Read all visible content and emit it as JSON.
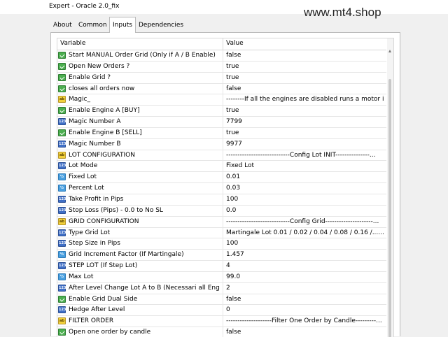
{
  "window": {
    "title": "Expert - Oracle 2.0_fix"
  },
  "watermark": "www.mt4.shop",
  "tabs": [
    {
      "label": "About",
      "active": false
    },
    {
      "label": "Common",
      "active": false
    },
    {
      "label": "Inputs",
      "active": true
    },
    {
      "label": "Dependencies",
      "active": false
    }
  ],
  "table": {
    "headers": {
      "variable": "Variable",
      "value": "Value"
    },
    "rows": [
      {
        "icon": "bool",
        "variable": "Start MANUAL Order  Grid  (Only if A / B Enable)",
        "value": "false"
      },
      {
        "icon": "bool",
        "variable": "Open New Orders ?",
        "value": "true"
      },
      {
        "icon": "bool",
        "variable": "Enable Grid ?",
        "value": "true"
      },
      {
        "icon": "bool",
        "variable": "closes all orders now",
        "value": "false"
      },
      {
        "icon": "ab",
        "variable": "Magic_",
        "value": "--------If all the engines are disabled runs a motor i..."
      },
      {
        "icon": "bool",
        "variable": "Enable Engine A   [BUY]",
        "value": "true"
      },
      {
        "icon": "int",
        "variable": "Magic Number  A",
        "value": "7799"
      },
      {
        "icon": "bool",
        "variable": "Enable Engine B   [SELL]",
        "value": "true"
      },
      {
        "icon": "int",
        "variable": "Magic Number  B",
        "value": "9977"
      },
      {
        "icon": "ab",
        "variable": "LOT CONFIGURATION",
        "value": "----------------------------Config Lot INIT---------------..."
      },
      {
        "icon": "int",
        "variable": "Lot Mode",
        "value": "Fixed Lot"
      },
      {
        "icon": "dbl",
        "variable": "Fixed Lot",
        "value": "0.01"
      },
      {
        "icon": "dbl",
        "variable": "Percent Lot",
        "value": "0.03"
      },
      {
        "icon": "int",
        "variable": "Take Profit in Pips",
        "value": "100"
      },
      {
        "icon": "int",
        "variable": "Stop Loss (Pips) - 0.0 to No SL",
        "value": "0.0"
      },
      {
        "icon": "ab",
        "variable": "GRID CONFIGURATION",
        "value": "----------------------------Config Grid---------------------..."
      },
      {
        "icon": "int",
        "variable": "Type Grid Lot",
        "value": "Martingale Lot  0.01 / 0.02 / 0.04 / 0.08 / 0.16 /........"
      },
      {
        "icon": "int",
        "variable": "Step Size in Pips",
        "value": "100"
      },
      {
        "icon": "dbl",
        "variable": "Grid Increment Factor (If Martingale)",
        "value": "1.457"
      },
      {
        "icon": "int",
        "variable": "STEP LOT (If  Step Lot)",
        "value": "4"
      },
      {
        "icon": "dbl",
        "variable": "Max Lot",
        "value": "99.0"
      },
      {
        "icon": "int",
        "variable": "After Level Change Lot A to B (Necessari all Engi...",
        "value": "2"
      },
      {
        "icon": "bool",
        "variable": "Enable Grid Dual Side",
        "value": "false"
      },
      {
        "icon": "int",
        "variable": "Hedge After Level",
        "value": "0"
      },
      {
        "icon": "ab",
        "variable": "FILTER ORDER",
        "value": "--------------------Filter One Order by Candle---------..."
      },
      {
        "icon": "bool",
        "variable": "Open one order by candle",
        "value": "false"
      }
    ]
  }
}
